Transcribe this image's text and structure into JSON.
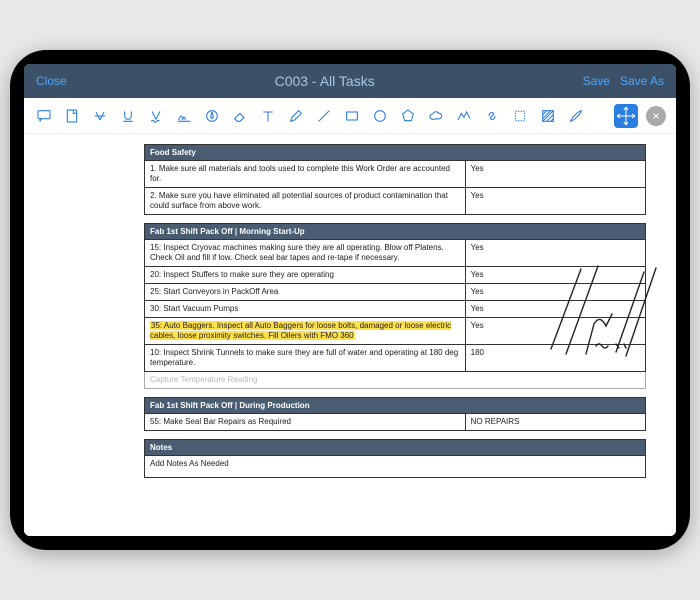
{
  "header": {
    "close": "Close",
    "title": "C003 - All Tasks",
    "save": "Save",
    "saveAs": "Save As"
  },
  "sections": [
    {
      "title": "Food Safety",
      "rows": [
        {
          "label": "1. Make sure all materials and tools used to complete this Work Order are accounted for.",
          "value": "Yes"
        },
        {
          "label": "2. Make sure you have eliminated all potential sources of product contamination that could surface from above work.",
          "value": "Yes"
        }
      ]
    },
    {
      "title": "Fab 1st Shift Pack Off | Morning Start-Up",
      "rows": [
        {
          "label": "15: Inspect Cryovac machines making sure they are all operating. Blow off Platens. Check Oil and fill if low. Check seal bar tapes and re-tape if necessary.",
          "value": "Yes"
        },
        {
          "label": "20: Inspect Stuffers to make sure they are operating",
          "value": "Yes"
        },
        {
          "label": "25: Start Conveyors in PackOff Area",
          "value": "Yes"
        },
        {
          "label": "30: Start Vacuum Pumps",
          "value": "Yes"
        },
        {
          "label": "35: Auto Baggers. Inspect all Auto Baggers for loose bolts, damaged or loose electric cables, loose proximity switches. Fill Oilers with FMO 360",
          "value": "Yes",
          "highlighted": true
        },
        {
          "label": "10: Inspect Shrink Tunnels to make sure they are full of water and operating at 180 deg temperature.",
          "value": "180"
        }
      ],
      "inputRow": "Capture Temperature Reading"
    },
    {
      "title": "Fab 1st Shift Pack Off | During Production",
      "rows": [
        {
          "label": "55: Make Seal Bar Repairs as Required",
          "value": "NO REPAIRS"
        }
      ]
    },
    {
      "title": "Notes",
      "rows": [
        {
          "label": "Add Notes As Needed",
          "value": ""
        }
      ]
    }
  ]
}
